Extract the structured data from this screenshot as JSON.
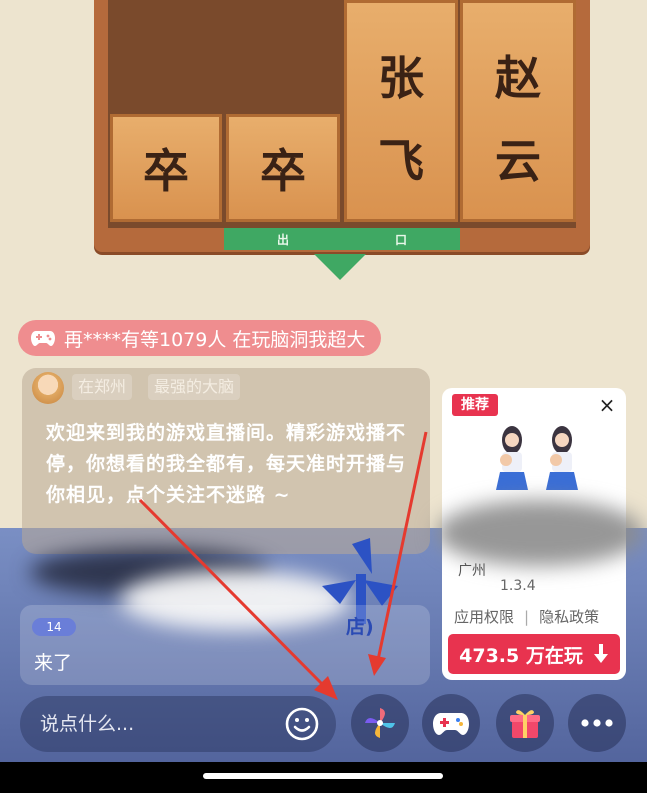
{
  "board": {
    "tiles": [
      "张",
      "飞",
      "赵",
      "云",
      "卒",
      "卒"
    ],
    "exit_left": "出",
    "exit_right": "口"
  },
  "banner": {
    "icon": "gamepad-icon",
    "text": "再****有等1079人 在玩脑洞我超大"
  },
  "host": {
    "location": "在郑州",
    "title": "最强的大脑"
  },
  "welcome": {
    "text": "欢迎来到我的游戏直播间。精彩游戏播不停，你想看的我全都有，每天准时开播与你相见，点个关注不迷路 ~"
  },
  "chat": {
    "level": "14",
    "name_tail": "店)",
    "message": "来了"
  },
  "recommend": {
    "tag": "推荐",
    "close": "×",
    "developer": "广州",
    "version": "1.3.4",
    "permissions": "应用权限",
    "privacy": "隐私政策",
    "separator": "|",
    "play_count": "473.5 万在玩",
    "download_icon": "download-arrow-icon"
  },
  "bottom": {
    "input_placeholder": "说点什么...",
    "buttons": [
      "emoji-icon",
      "pinwheel-icon",
      "game-controller-icon",
      "gift-icon",
      "more-icon"
    ]
  },
  "colors": {
    "accent": "#e8334f",
    "banner": "#ef8d8f",
    "board": "#b56a3c",
    "exit": "#3fa863"
  }
}
